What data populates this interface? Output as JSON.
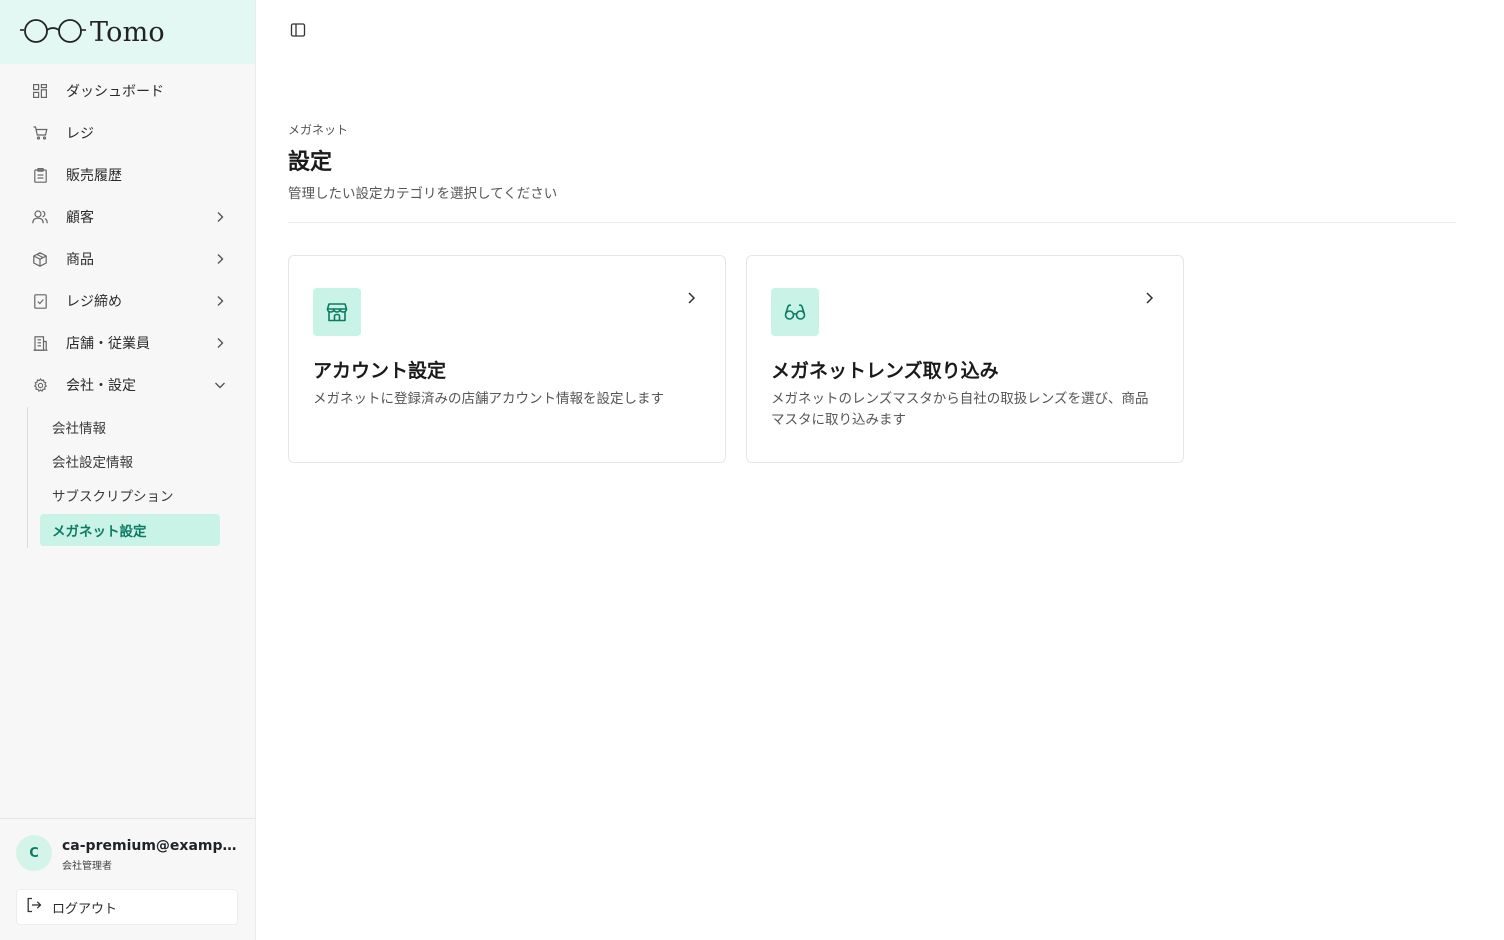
{
  "brand": {
    "name": "Tomo",
    "accent": "#0e7a64",
    "accent_bg": "#c9f3e6",
    "logo_bg": "#e3f8f2"
  },
  "sidebar": {
    "items": [
      {
        "label": "ダッシュボード",
        "icon": "dashboard-icon"
      },
      {
        "label": "レジ",
        "icon": "cart-icon"
      },
      {
        "label": "販売履歴",
        "icon": "clipboard-icon"
      },
      {
        "label": "顧客",
        "icon": "users-icon",
        "expandable": true
      },
      {
        "label": "商品",
        "icon": "package-icon",
        "expandable": true
      },
      {
        "label": "レジ締め",
        "icon": "receipt-icon",
        "expandable": true
      },
      {
        "label": "店舗・従業員",
        "icon": "building-icon",
        "expandable": true
      },
      {
        "label": "会社・設定",
        "icon": "gear-icon",
        "expandable": true,
        "expanded": true
      }
    ],
    "subitems": [
      {
        "label": "会社情報"
      },
      {
        "label": "会社設定情報"
      },
      {
        "label": "サブスクリプション"
      },
      {
        "label": "メガネット設定",
        "active": true
      }
    ]
  },
  "user": {
    "initial": "C",
    "email": "ca-premium@example.com",
    "role": "会社管理者"
  },
  "logout_label": "ログアウト",
  "page": {
    "eyebrow": "メガネット",
    "title": "設定",
    "subtitle": "管理したい設定カテゴリを選択してください"
  },
  "cards": [
    {
      "title": "アカウント設定",
      "description": "メガネットに登録済みの店舗アカウント情報を設定します",
      "icon": "store-icon"
    },
    {
      "title": "メガネットレンズ取り込み",
      "description": "メガネットのレンズマスタから自社の取扱レンズを選び、商品マスタに取り込みます",
      "icon": "glasses-icon"
    }
  ]
}
